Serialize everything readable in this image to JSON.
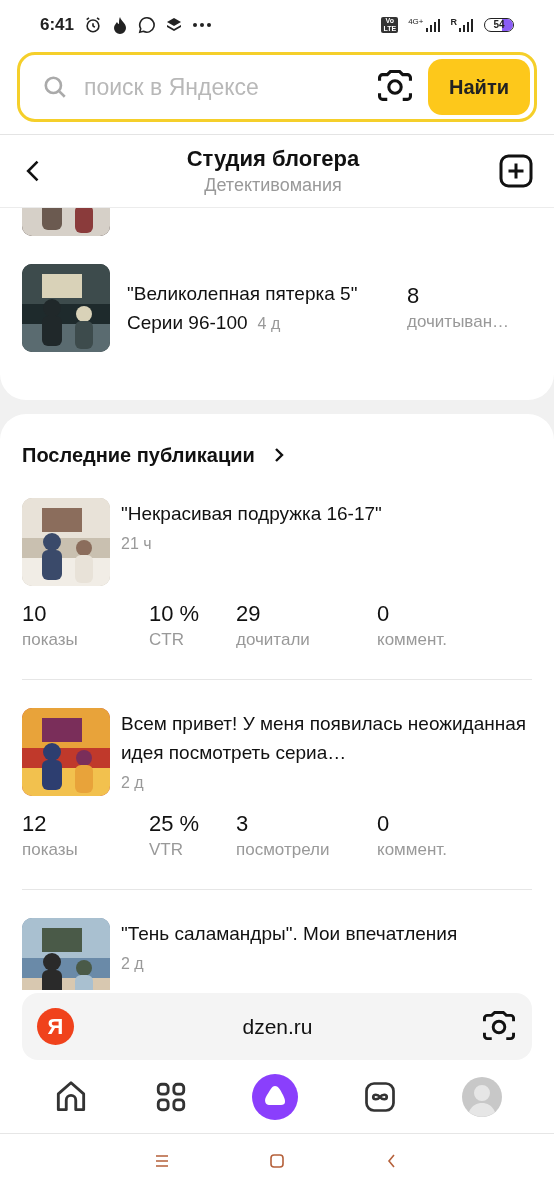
{
  "status_bar": {
    "time": "6:41",
    "volte": [
      "Vo",
      "LTE"
    ],
    "network": "4G+",
    "roaming": "R",
    "battery": "54"
  },
  "search": {
    "placeholder": "поиск в Яндексе",
    "button": "Найти"
  },
  "header": {
    "title": "Студия блогера",
    "subtitle": "Детективомания"
  },
  "top_items": [
    {
      "title": "\"Великолепная пятерка 5\"",
      "subtitle": "Серии 96-100",
      "age": "4 д",
      "value": "8",
      "metric": "дочитыван…"
    }
  ],
  "latest": {
    "heading": "Последние публикации",
    "publications": [
      {
        "title": "\"Некрасивая подружка 16-17\"",
        "age": "21 ч",
        "stats": [
          {
            "value": "10",
            "label": "показы"
          },
          {
            "value": "10 %",
            "label": "CTR"
          },
          {
            "value": "29",
            "label": "дочитали"
          },
          {
            "value": "0",
            "label": "коммент."
          }
        ]
      },
      {
        "title": "Всем привет! У меня появилась неожиданная идея посмотреть сериа…",
        "age": "2 д",
        "stats": [
          {
            "value": "12",
            "label": "показы"
          },
          {
            "value": "25 %",
            "label": "VTR"
          },
          {
            "value": "3",
            "label": "посмотрели"
          },
          {
            "value": "0",
            "label": "коммент."
          }
        ]
      },
      {
        "title": "\"Тень саламандры\". Мои впечатления",
        "age": "2 д"
      }
    ]
  },
  "address_bar": {
    "logo": "Я",
    "url": "dzen.ru"
  },
  "nav_items": [
    {
      "kind": "home"
    },
    {
      "kind": "apps"
    },
    {
      "kind": "alice"
    },
    {
      "kind": "services"
    },
    {
      "kind": "profile"
    }
  ],
  "system_nav": [
    {
      "kind": "menu"
    },
    {
      "kind": "home"
    },
    {
      "kind": "back"
    }
  ]
}
